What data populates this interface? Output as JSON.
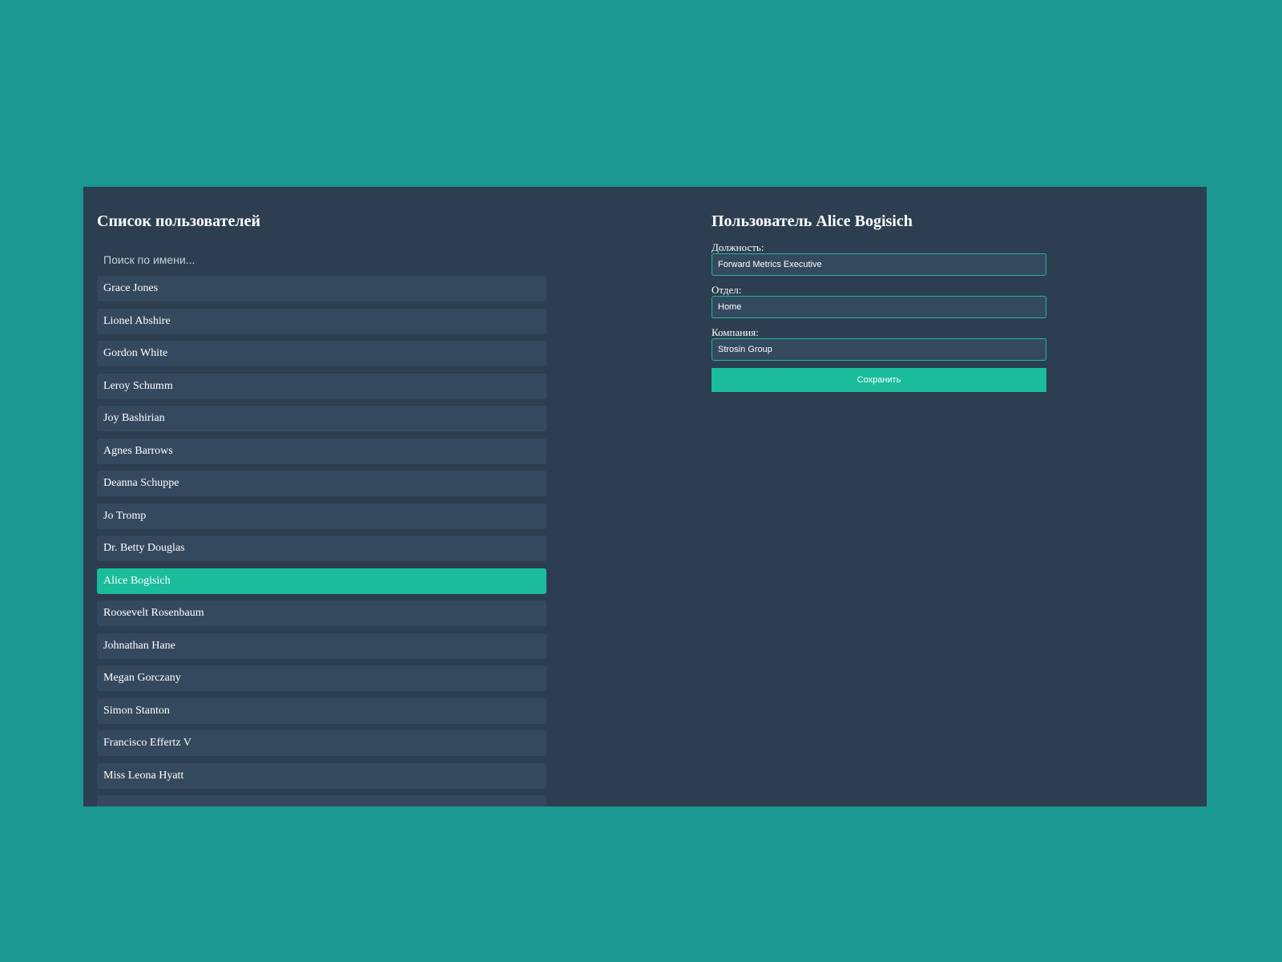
{
  "colors": {
    "page_background": "#1a9891",
    "panel_background": "#2c3e50",
    "list_item": "#34495e",
    "accent": "#1abc9c",
    "text": "#ffffff"
  },
  "user_list": {
    "title": "Список пользователей",
    "search_placeholder": "Поиск по имени...",
    "search_value": "",
    "selected_index": 9,
    "items": [
      "Grace Jones",
      "Lionel Abshire",
      "Gordon White",
      "Leroy Schumm",
      "Joy Bashirian",
      "Agnes Barrows",
      "Deanna Schuppe",
      "Jo Tromp",
      "Dr. Betty Douglas",
      "Alice Bogisich",
      "Roosevelt Rosenbaum",
      "Johnathan Hane",
      "Megan Gorczany",
      "Simon Stanton",
      "Francisco Effertz V",
      "Miss Leona Hyatt"
    ]
  },
  "editor": {
    "title": "Пользователь Alice Bogisich",
    "position_label": "Должность:",
    "position_value": "Forward Metrics Executive",
    "department_label": "Отдел:",
    "department_value": "Home",
    "company_label": "Компания:",
    "company_value": "Strosin Group",
    "save_label": "Сохранить"
  }
}
